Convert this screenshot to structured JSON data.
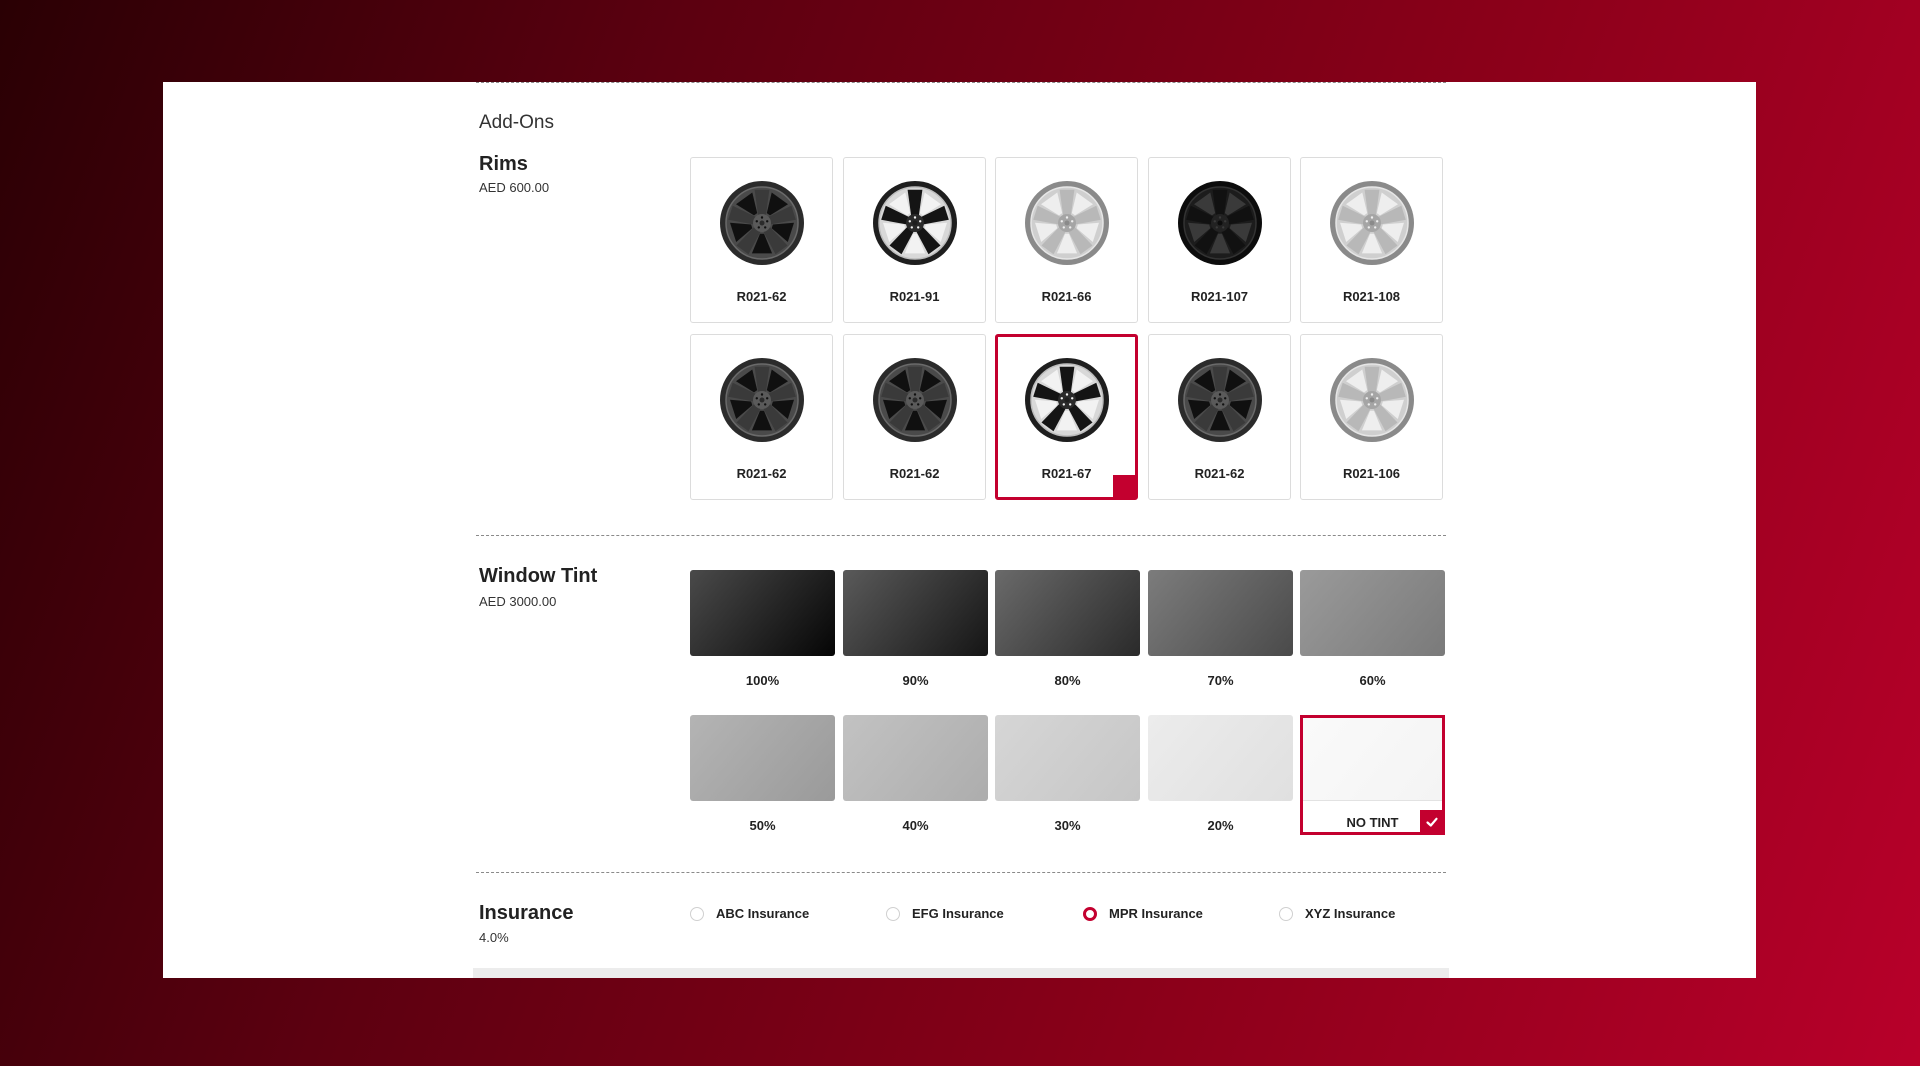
{
  "colors": {
    "accent": "#c3002f",
    "panel_background": "#ffffff"
  },
  "section_heading": "Add-Ons",
  "rims": {
    "title": "Rims",
    "price": "AED 600.00",
    "items": [
      {
        "label": "R021-62",
        "style": "dark-gray"
      },
      {
        "label": "R021-91",
        "style": "black-machined"
      },
      {
        "label": "R021-66",
        "style": "silver"
      },
      {
        "label": "R021-107",
        "style": "black"
      },
      {
        "label": "R021-108",
        "style": "silver"
      },
      {
        "label": "R021-62",
        "style": "dark-gray"
      },
      {
        "label": "R021-62",
        "style": "dark-gray"
      },
      {
        "label": "R021-67",
        "style": "black-machined",
        "selected": true
      },
      {
        "label": "R021-62",
        "style": "dark-gray"
      },
      {
        "label": "R021-106",
        "style": "silver"
      }
    ]
  },
  "window_tint": {
    "title": "Window Tint",
    "price": "AED 3000.00",
    "items": [
      {
        "label": "100%",
        "from": "#4a4a4a",
        "to": "#050505"
      },
      {
        "label": "90%",
        "from": "#5a5a5a",
        "to": "#151515"
      },
      {
        "label": "80%",
        "from": "#6a6a6a",
        "to": "#2a2a2a"
      },
      {
        "label": "70%",
        "from": "#7c7c7c",
        "to": "#4a4a4a"
      },
      {
        "label": "60%",
        "from": "#9a9a9a",
        "to": "#7a7a7a"
      },
      {
        "label": "50%",
        "from": "#b4b4b4",
        "to": "#9a9a9a"
      },
      {
        "label": "40%",
        "from": "#c2c2c2",
        "to": "#adadad"
      },
      {
        "label": "30%",
        "from": "#d6d6d6",
        "to": "#c6c6c6"
      },
      {
        "label": "20%",
        "from": "#ececec",
        "to": "#e0e0e0"
      },
      {
        "label": "NO TINT",
        "from": "#fafafa",
        "to": "#f4f4f4",
        "selected": true
      }
    ]
  },
  "insurance": {
    "title": "Insurance",
    "rate": "4.0%",
    "options": [
      {
        "label": "ABC Insurance",
        "checked": false
      },
      {
        "label": "EFG Insurance",
        "checked": false
      },
      {
        "label": "MPR Insurance",
        "checked": true
      },
      {
        "label": "XYZ Insurance",
        "checked": false
      }
    ]
  },
  "icons": {
    "selected_mark": "checkmark-icon",
    "rim": "rim-wheel-icon"
  }
}
